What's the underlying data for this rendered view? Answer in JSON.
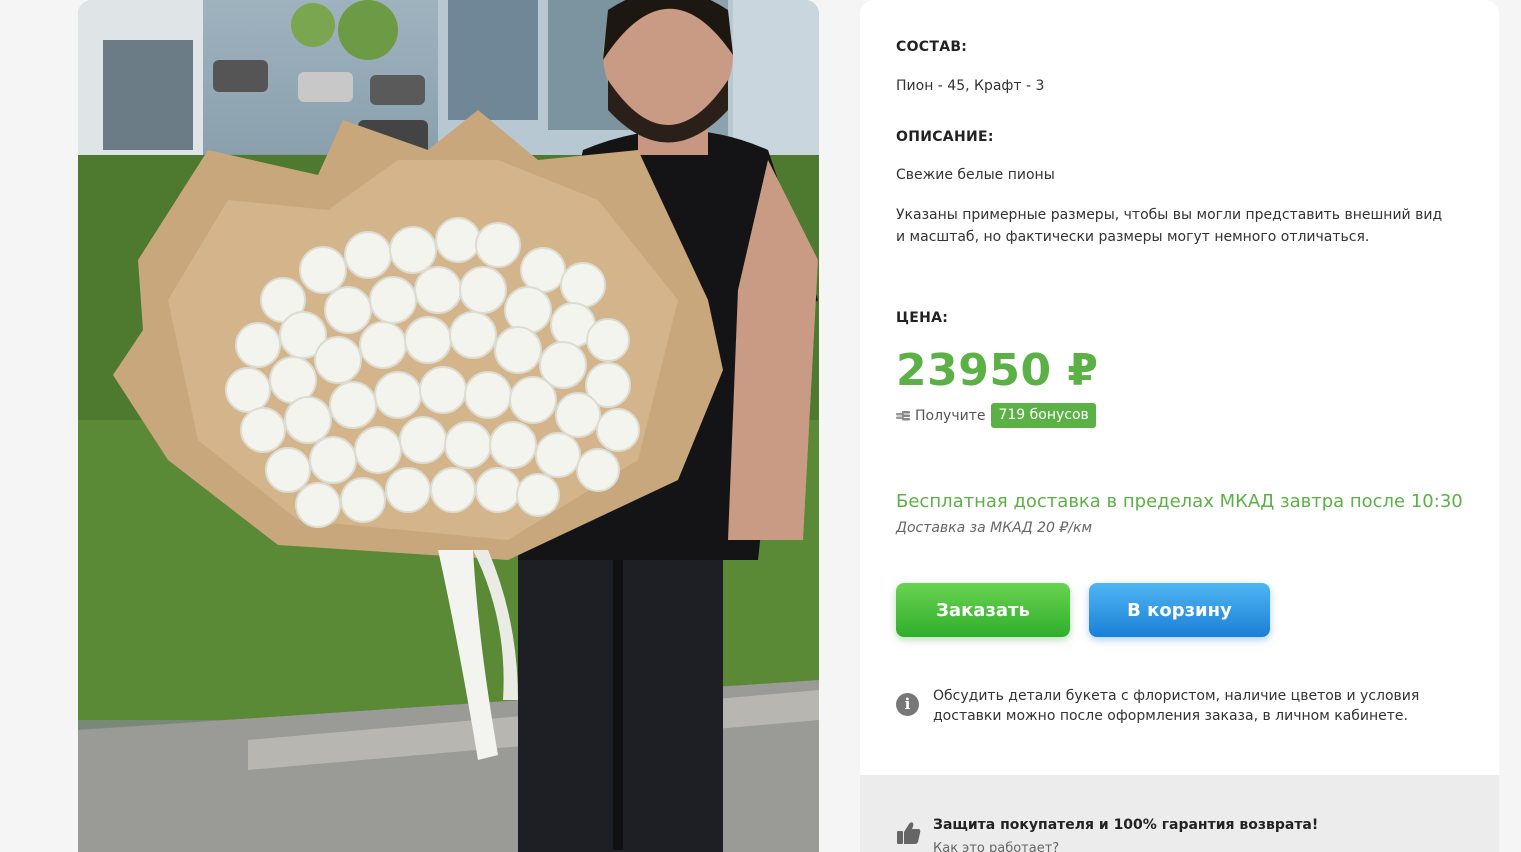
{
  "product": {
    "photo_icon": "bouquet-photo",
    "composition_label": "СОСТАВ:",
    "composition_value": "Пион - 45, Крафт - 3",
    "description_label": "ОПИСАНИЕ:",
    "description_value": "Свежие белые пионы",
    "size_note_line1": "Указаны примерные размеры, чтобы вы могли представить внешний вид",
    "size_note_line2": "и масштаб, но фактически размеры могут немного отличаться.",
    "price_label": "ЦЕНА:",
    "price_value": "23950 ₽",
    "bonus_prefix": "Получите",
    "bonus_badge": "719 бонусов",
    "bonus_icon": "coins-icon"
  },
  "delivery": {
    "main": "Бесплатная доставка в пределах МКАД завтра после 10:30",
    "sub": "Доставка за МКАД 20 ₽/км"
  },
  "actions": {
    "order_label": "Заказать",
    "cart_label": "В корзину"
  },
  "info": {
    "icon": "info-icon",
    "line1": "Обсудить детали букета с флористом, наличие цветов и условия",
    "line2": "доставки можно после оформления заказа, в личном кабинете."
  },
  "guarantee": {
    "icon": "thumbs-up-icon",
    "title": "Защита покупателя и 100% гарантия возврата!",
    "link": "Как это работает?"
  },
  "colors": {
    "accent_green": "#5bb145",
    "order_button": "#3cbf37",
    "cart_button": "#2a95e6"
  }
}
